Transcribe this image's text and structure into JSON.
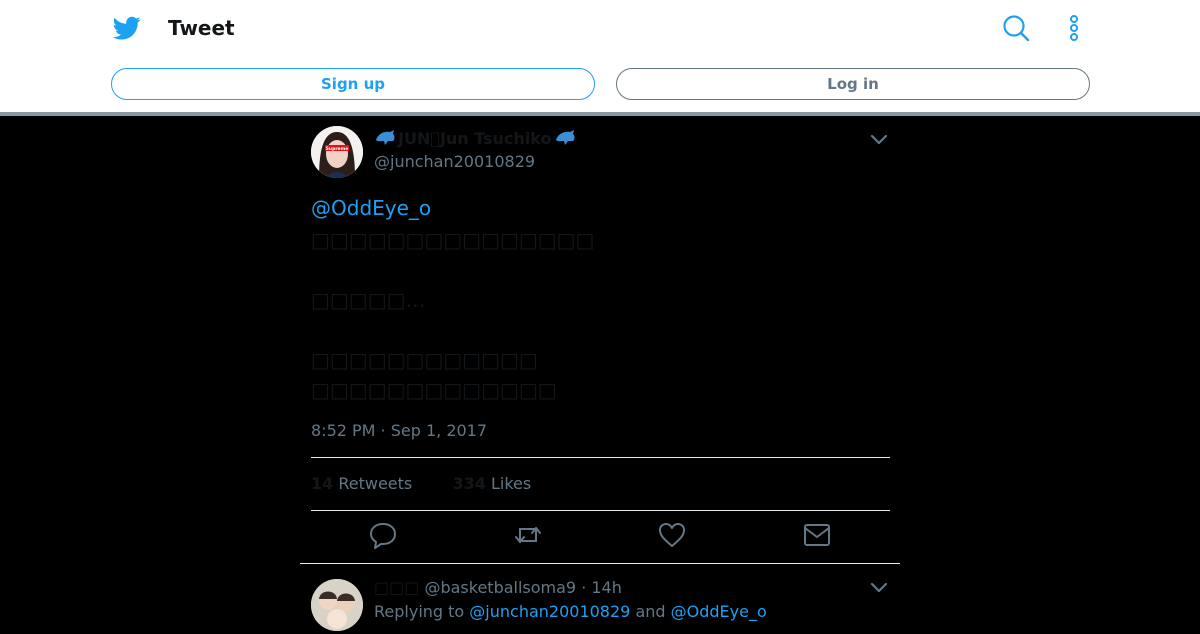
{
  "header": {
    "title": "Tweet",
    "signup_label": "Sign up",
    "login_label": "Log in",
    "brand_color": "#1da1f2"
  },
  "tweet": {
    "display_name": "JUN\u0000Jun Tsuchiko",
    "handle": "@junchan20010829",
    "mention": "@OddEye_o",
    "lines": [
      "□□□□□□□□□□□□□□□",
      "□□□□□…",
      "□□□□□□□□□□□□",
      "□□□□□□□□□□□□□"
    ],
    "timestamp": "8:52 PM · Sep 1, 2017",
    "retweets_count": "14",
    "retweets_label": "Retweets",
    "likes_count": "334",
    "likes_label": "Likes"
  },
  "reply": {
    "display_name": "□□□",
    "handle_time": "@basketballsoma9 · 14h",
    "replying_prefix": "Replying to",
    "replying_user1": "@junchan20010829",
    "replying_and": "and",
    "replying_user2": "@OddEye_o"
  }
}
